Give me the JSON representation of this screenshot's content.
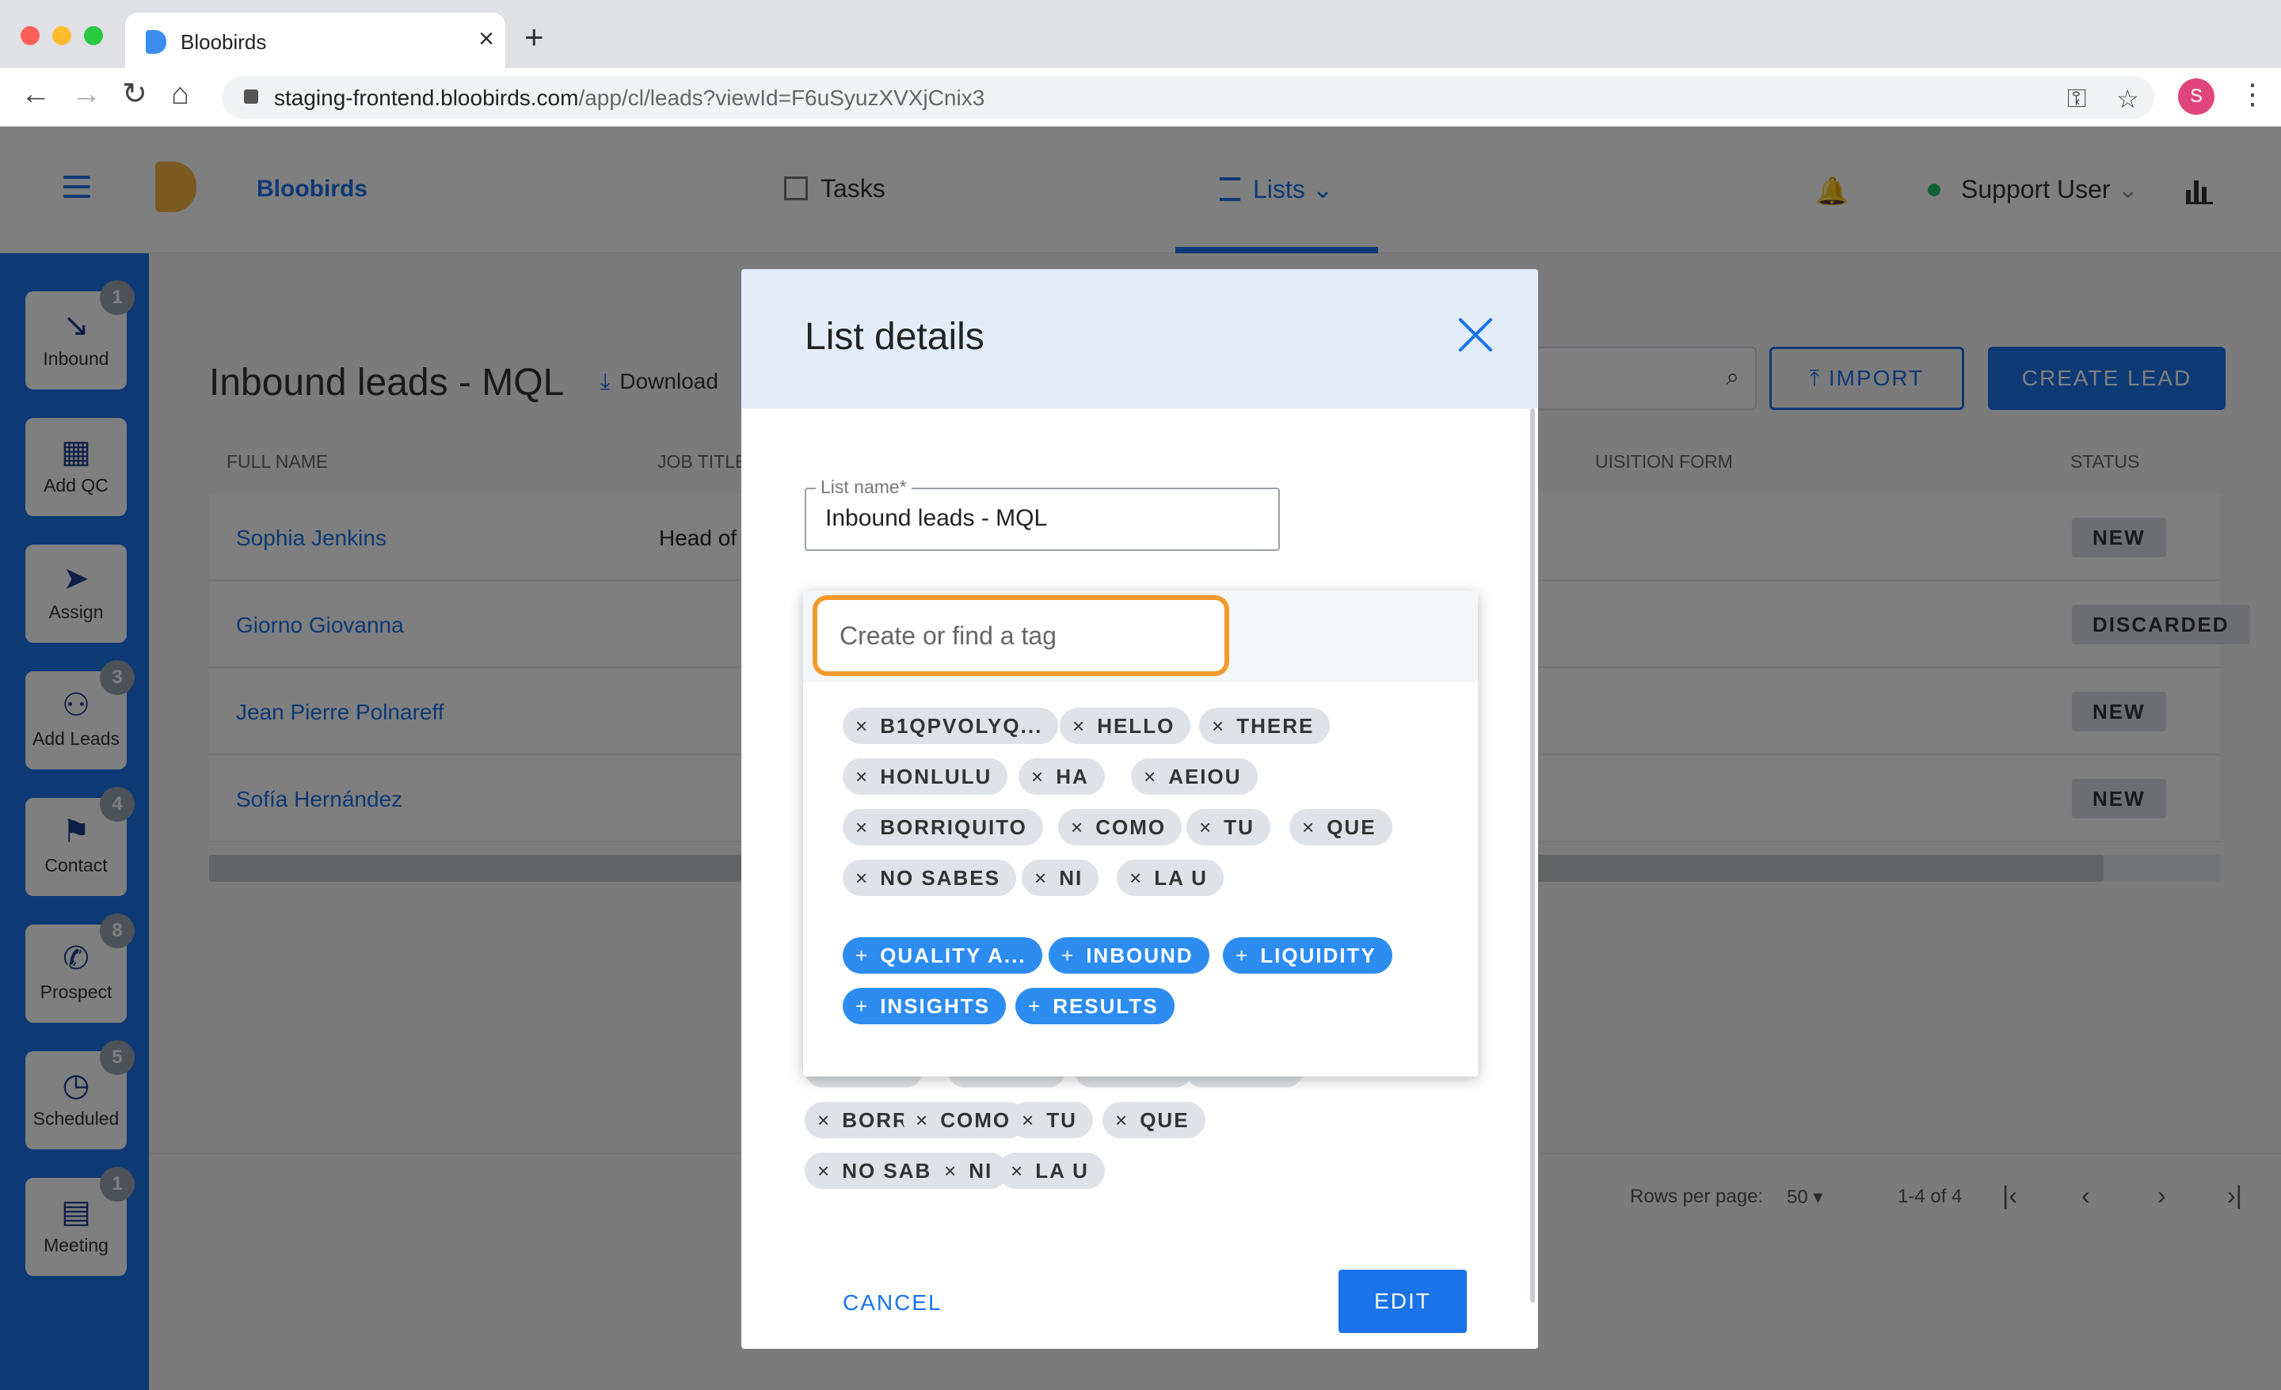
{
  "browser": {
    "tab_title": "Bloobirds",
    "url_host": "staging-frontend.bloobirds.com",
    "url_path": "/app/cl/leads?viewId=F6uSyuzXVXjCnix3",
    "profile_initial": "S"
  },
  "header": {
    "brand": "Bloobirds",
    "nav_tasks": "Tasks",
    "nav_lists": "Lists",
    "user_name": "Support User"
  },
  "sidebar": {
    "items": [
      {
        "label": "Inbound",
        "icon": "↘",
        "badge": "1"
      },
      {
        "label": "Add QC",
        "icon": "▦",
        "badge": ""
      },
      {
        "label": "Assign",
        "icon": "➤",
        "badge": ""
      },
      {
        "label": "Add Leads",
        "icon": "⚇",
        "badge": "3"
      },
      {
        "label": "Contact",
        "icon": "⚑",
        "badge": "4"
      },
      {
        "label": "Prospect",
        "icon": "✆",
        "badge": "8"
      },
      {
        "label": "Scheduled",
        "icon": "◷",
        "badge": "5"
      },
      {
        "label": "Meeting",
        "icon": "▤",
        "badge": "1"
      }
    ]
  },
  "page": {
    "title": "Inbound leads - MQL",
    "download": "Download",
    "import": "IMPORT",
    "create_lead": "CREATE LEAD"
  },
  "table": {
    "columns": [
      "FULL NAME",
      "JOB TITLE",
      "UISITION FORM",
      "STATUS"
    ],
    "rows": [
      {
        "name": "Sophia Jenkins",
        "job": "Head of",
        "status": "NEW"
      },
      {
        "name": "Giorno Giovanna",
        "job": "",
        "status": "DISCARDED"
      },
      {
        "name": "Jean Pierre Polnareff",
        "job": "",
        "status": "NEW"
      },
      {
        "name": "Sofía Hernández",
        "job": "",
        "status": "NEW"
      }
    ]
  },
  "pagination": {
    "rows_per_page_label": "Rows per page:",
    "rows_per_page": "50",
    "range": "1-4 of 4"
  },
  "modal": {
    "title": "List details",
    "list_name_label": "List name*",
    "list_name_value": "Inbound leads - MQL",
    "tag_placeholder": "Create or find a tag",
    "cancel": "CANCEL",
    "edit": "EDIT",
    "selected_tags": [
      "B1QPVOLYQ...",
      "HELLO",
      "THERE",
      "HONLULU",
      "HA",
      "AEIOU",
      "BORRIQUITO",
      "COMO",
      "TU",
      "QUE",
      "NO SABES",
      "NI",
      "LA U"
    ],
    "suggested_tags": [
      "QUALITY A...",
      "INBOUND",
      "LIQUIDITY",
      "INSIGHTS",
      "RESULTS"
    ],
    "underlying_tags": [
      "BORRIQUITO",
      "COMO",
      "TU",
      "QUE",
      "NO SABES",
      "NI",
      "LA U"
    ]
  },
  "colors": {
    "accent": "#1a73e8",
    "focus_ring": "#f39a2d",
    "chip_add": "#2d8cf0"
  }
}
